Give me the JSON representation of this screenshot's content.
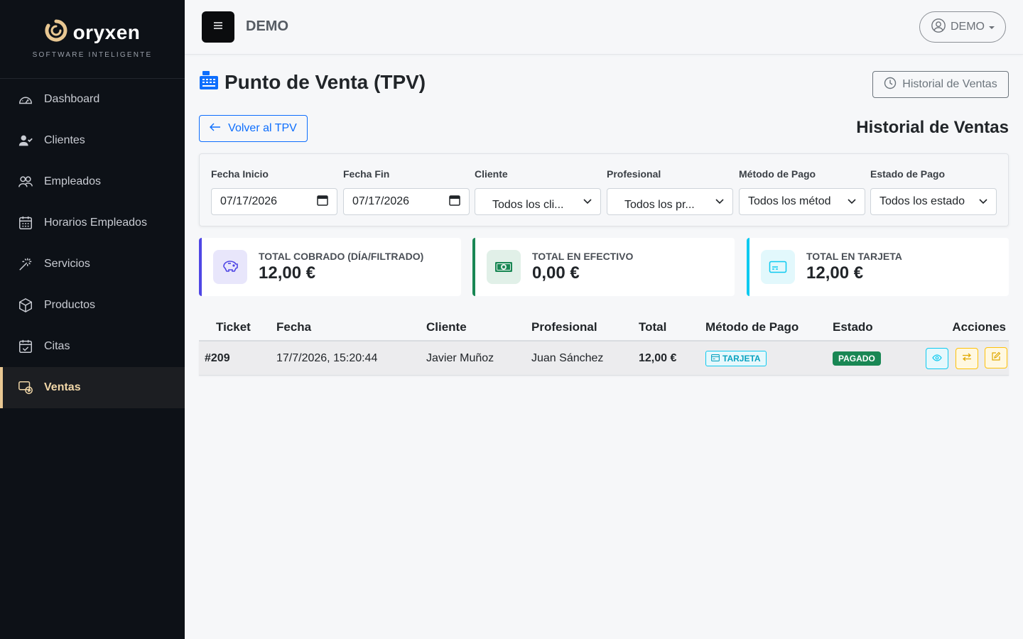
{
  "brand": {
    "name": "oryxen",
    "tagline": "SOFTWARE INTELIGENTE",
    "accent": "#e8c792"
  },
  "sidebar": {
    "items": [
      {
        "label": "Dashboard",
        "icon": "speedometer-icon"
      },
      {
        "label": "Clientes",
        "icon": "user-check-icon"
      },
      {
        "label": "Empleados",
        "icon": "people-icon"
      },
      {
        "label": "Horarios Empleados",
        "icon": "calendar-grid-icon"
      },
      {
        "label": "Servicios",
        "icon": "magic-wand-icon"
      },
      {
        "label": "Productos",
        "icon": "box-icon"
      },
      {
        "label": "Citas",
        "icon": "calendar-check-icon"
      },
      {
        "label": "Ventas",
        "icon": "cash-register-icon",
        "active": true
      }
    ]
  },
  "topbar": {
    "title": "DEMO",
    "user": "DEMO"
  },
  "page": {
    "title": "Punto de Venta (TPV)",
    "history_button": "Historial de Ventas",
    "back_button": "Volver al TPV",
    "section_title": "Historial de Ventas"
  },
  "filters": {
    "fecha_inicio": {
      "label": "Fecha Inicio",
      "value": "07/17/2026"
    },
    "fecha_fin": {
      "label": "Fecha Fin",
      "value": "07/17/2026"
    },
    "cliente": {
      "label": "Cliente",
      "value": "Todos los cli..."
    },
    "profesional": {
      "label": "Profesional",
      "value": "Todos los pr..."
    },
    "metodo": {
      "label": "Método de Pago",
      "value": "Todos los métod"
    },
    "estado": {
      "label": "Estado de Pago",
      "value": "Todos los estado"
    }
  },
  "stats": [
    {
      "label": "TOTAL COBRADO (DÍA/FILTRADO)",
      "value": "12,00 €",
      "color": "#4f46e5"
    },
    {
      "label": "TOTAL EN EFECTIVO",
      "value": "0,00 €",
      "color": "#198754"
    },
    {
      "label": "TOTAL EN TARJETA",
      "value": "12,00 €",
      "color": "#0dcaf0"
    }
  ],
  "table": {
    "headers": [
      "Ticket",
      "Fecha",
      "Cliente",
      "Profesional",
      "Total",
      "Método de Pago",
      "Estado",
      "Acciones"
    ],
    "rows": [
      {
        "ticket": "#209",
        "fecha": "17/7/2026, 15:20:44",
        "cliente": "Javier Muñoz",
        "profesional": "Juan Sánchez",
        "total": "12,00 €",
        "metodo": "TARJETA",
        "estado": "PAGADO"
      }
    ]
  }
}
